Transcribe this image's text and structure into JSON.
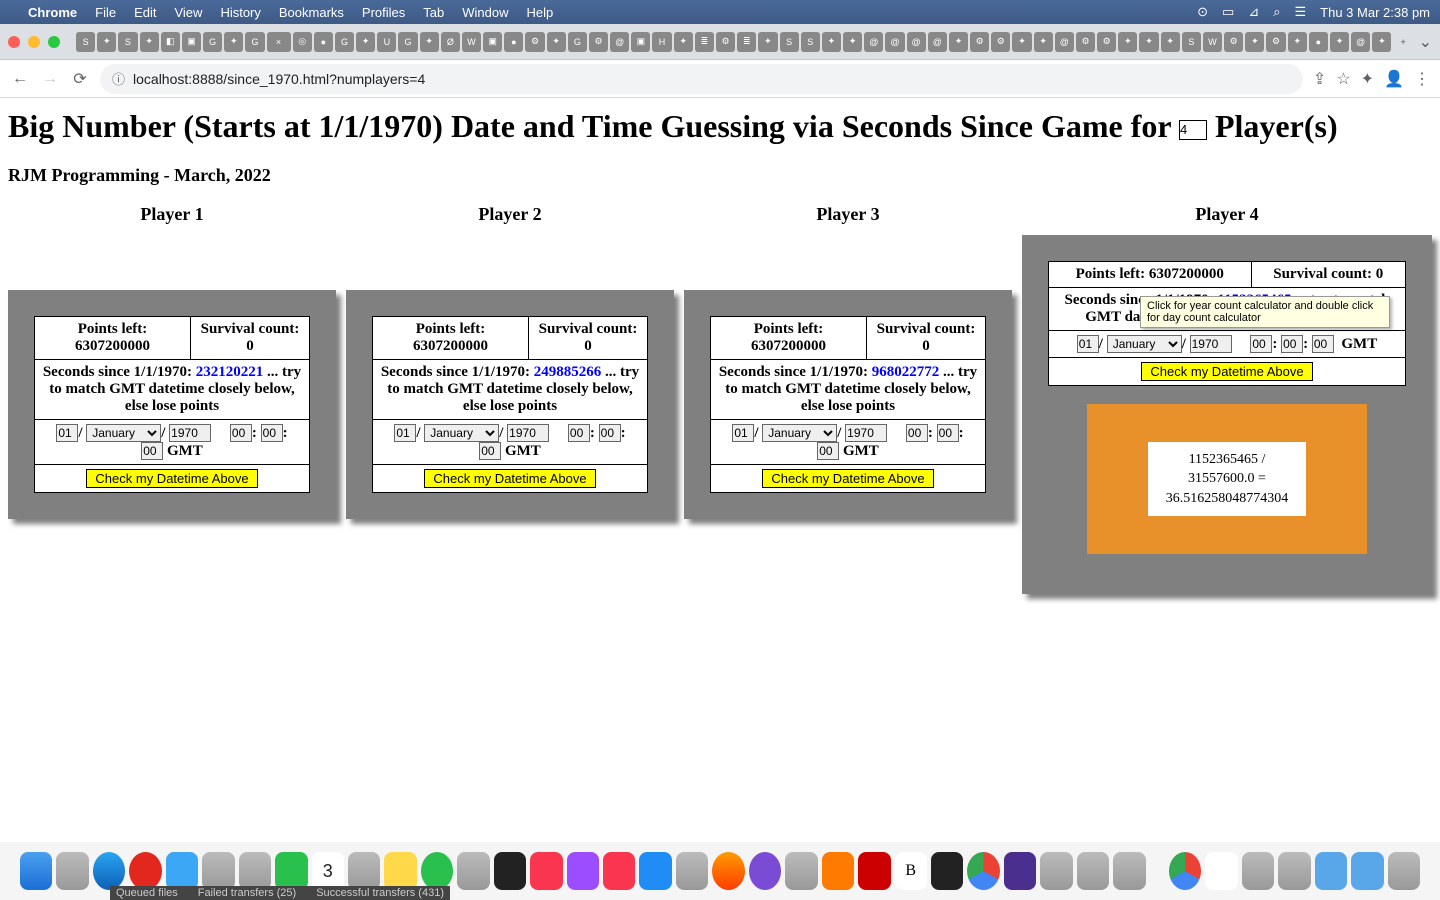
{
  "menubar": {
    "apple": "",
    "app": "Chrome",
    "items": [
      "File",
      "Edit",
      "View",
      "History",
      "Bookmarks",
      "Profiles",
      "Tab",
      "Window",
      "Help"
    ],
    "datetime": "Thu 3 Mar  2:38 pm"
  },
  "address": {
    "info_icon": "ⓘ",
    "url": "localhost:8888/since_1970.html?numplayers=4"
  },
  "nav": {
    "back": "←",
    "forward": "→",
    "reload": "⟳",
    "share": "⇪",
    "star": "☆",
    "ext": "✦",
    "avatar": "👤",
    "menu": "⋮"
  },
  "page": {
    "title_pre": "Big Number (Starts at 1/1/1970) Date and Time Guessing via Seconds Since Game for ",
    "title_post": " Player(s)",
    "num_players": "4",
    "subtitle": "RJM Programming - March, 2022"
  },
  "players": [
    {
      "name": "Player 1",
      "points_label": "Points left: 6307200000",
      "survival_label": "Survival count: 0",
      "seconds_label_pre": "Seconds since 1/1/1970: ",
      "seconds_value": "232120221",
      "seconds_label_post": " ... try to match GMT datetime closely below, else lose points",
      "day": "01",
      "month": "January",
      "year": "1970",
      "hh": "00",
      "mm": "00",
      "ss": "00",
      "tz": "GMT",
      "check_label": "Check my Datetime Above"
    },
    {
      "name": "Player 2",
      "points_label": "Points left: 6307200000",
      "survival_label": "Survival count: 0",
      "seconds_label_pre": "Seconds since 1/1/1970: ",
      "seconds_value": "249885266",
      "seconds_label_post": " ... try to match GMT datetime closely below, else lose points",
      "day": "01",
      "month": "January",
      "year": "1970",
      "hh": "00",
      "mm": "00",
      "ss": "00",
      "tz": "GMT",
      "check_label": "Check my Datetime Above"
    },
    {
      "name": "Player 3",
      "points_label": "Points left: 6307200000",
      "survival_label": "Survival count: 0",
      "seconds_label_pre": "Seconds since 1/1/1970: ",
      "seconds_value": "968022772",
      "seconds_label_post": " ... try to match GMT datetime closely below, else lose points",
      "day": "01",
      "month": "January",
      "year": "1970",
      "hh": "00",
      "mm": "00",
      "ss": "00",
      "tz": "GMT",
      "check_label": "Check my Datetime Above"
    },
    {
      "name": "Player 4",
      "points_label": "Points left: 6307200000",
      "survival_label": "Survival count: 0",
      "seconds_label_pre": "Seconds since 1/1/1970: ",
      "seconds_value": "1152365465",
      "seconds_label_post": " ... try to match GMT datetime closely below, else lose points",
      "day": "01",
      "month": "January",
      "year": "1970",
      "hh": "00",
      "mm": "00",
      "ss": "00",
      "tz": "GMT",
      "check_label": "Check my Datetime Above",
      "calc_line1": "1152365465 /",
      "calc_line2": "31557600.0 =",
      "calc_line3": "36.516258048774304"
    }
  ],
  "tooltip": "Click for year count calculator and double click for day count calculator",
  "status_bar": {
    "queued": "Queued files",
    "failed": "Failed transfers (25)",
    "success": "Successful transfers (431)"
  },
  "labels": {
    "slash": "/",
    "colon": ":"
  }
}
